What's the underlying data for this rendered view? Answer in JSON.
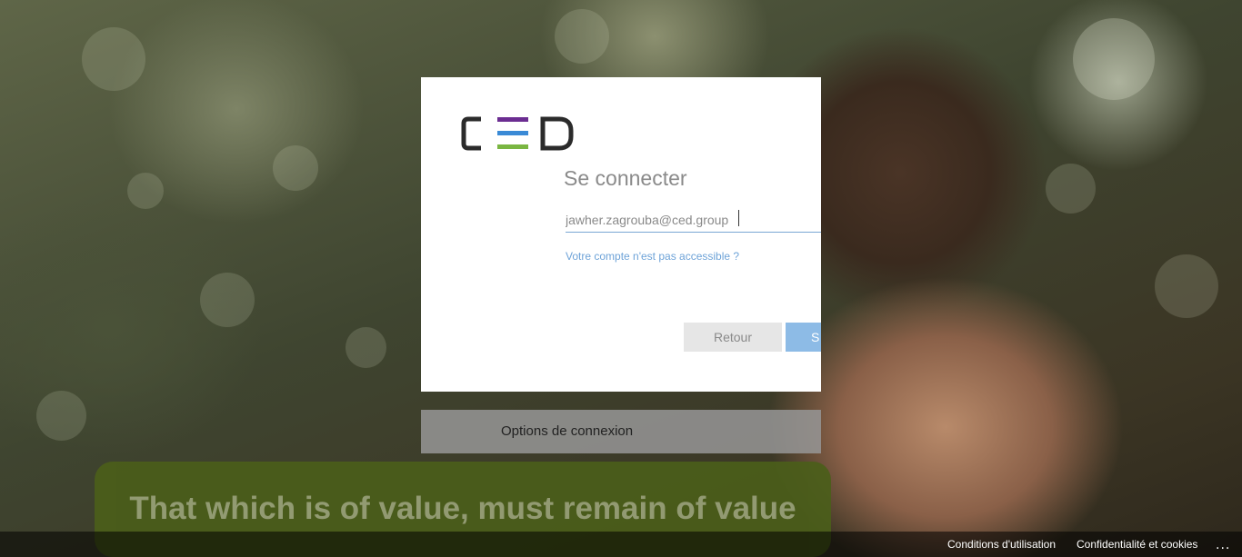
{
  "logo": {
    "text": "CED",
    "bar_colors": [
      "#6b2d91",
      "#3a8ad6",
      "#7ab642"
    ]
  },
  "signin": {
    "title": "Se connecter",
    "email_value": "jawher.zagrouba@ced.group",
    "help_link": "Votre compte n'est pas accessible ?",
    "back_label": "Retour",
    "next_label": "S"
  },
  "options": {
    "label": "Options de connexion"
  },
  "banner": {
    "text": "That which is of value, must remain of value"
  },
  "footer": {
    "terms": "Conditions d'utilisation",
    "privacy": "Confidentialité et cookies",
    "more": "..."
  }
}
